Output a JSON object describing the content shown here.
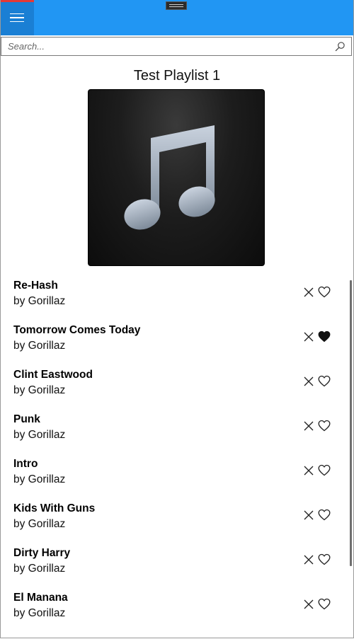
{
  "search": {
    "placeholder": "Search..."
  },
  "playlist": {
    "title": "Test Playlist 1",
    "art_icon": "music-note-icon"
  },
  "colors": {
    "topbar": "#2196f3",
    "hamburger_bg": "#1a7fd4",
    "accent_red": "#e53935"
  },
  "songs": [
    {
      "title": "Re-Hash",
      "artist": "by Gorillaz",
      "favorite": false
    },
    {
      "title": "Tomorrow Comes Today",
      "artist": "by Gorillaz",
      "favorite": true
    },
    {
      "title": "Clint Eastwood",
      "artist": "by Gorillaz",
      "favorite": false
    },
    {
      "title": "Punk",
      "artist": "by Gorillaz",
      "favorite": false
    },
    {
      "title": "Intro",
      "artist": "by Gorillaz",
      "favorite": false
    },
    {
      "title": "Kids With Guns",
      "artist": "by Gorillaz",
      "favorite": false
    },
    {
      "title": "Dirty Harry",
      "artist": "by Gorillaz",
      "favorite": false
    },
    {
      "title": "El Manana",
      "artist": "by Gorillaz",
      "favorite": false
    }
  ]
}
